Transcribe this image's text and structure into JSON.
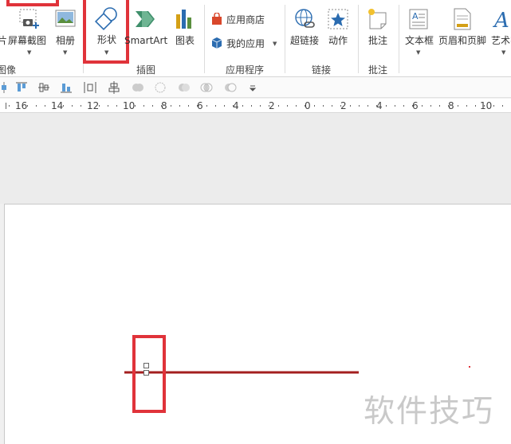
{
  "ribbon": {
    "groups": {
      "images": {
        "label": "图像",
        "picture_partial": "片",
        "screenshot": "屏幕截图",
        "album": "相册"
      },
      "illustrations": {
        "label": "插图",
        "shapes": "形状",
        "smartart": "SmartArt",
        "chart": "图表"
      },
      "apps": {
        "label": "应用程序",
        "store": "应用商店",
        "my_apps": "我的应用"
      },
      "links": {
        "label": "链接",
        "hyperlink": "超链接",
        "action": "动作"
      },
      "comments": {
        "label": "批注",
        "comment": "批注"
      },
      "text": {
        "textbox": "文本框",
        "header_footer": "页眉和页脚",
        "wordart": "艺术字"
      }
    }
  },
  "ruler": {
    "labels": [
      "16",
      "14",
      "12",
      "10",
      "8",
      "6",
      "4",
      "2",
      "0",
      "2",
      "4",
      "6",
      "8",
      "10"
    ]
  },
  "watermark": "软件技巧",
  "colors": {
    "highlight": "#e0333a",
    "line": "#a31f1f",
    "accent": "#2b6cb0"
  }
}
